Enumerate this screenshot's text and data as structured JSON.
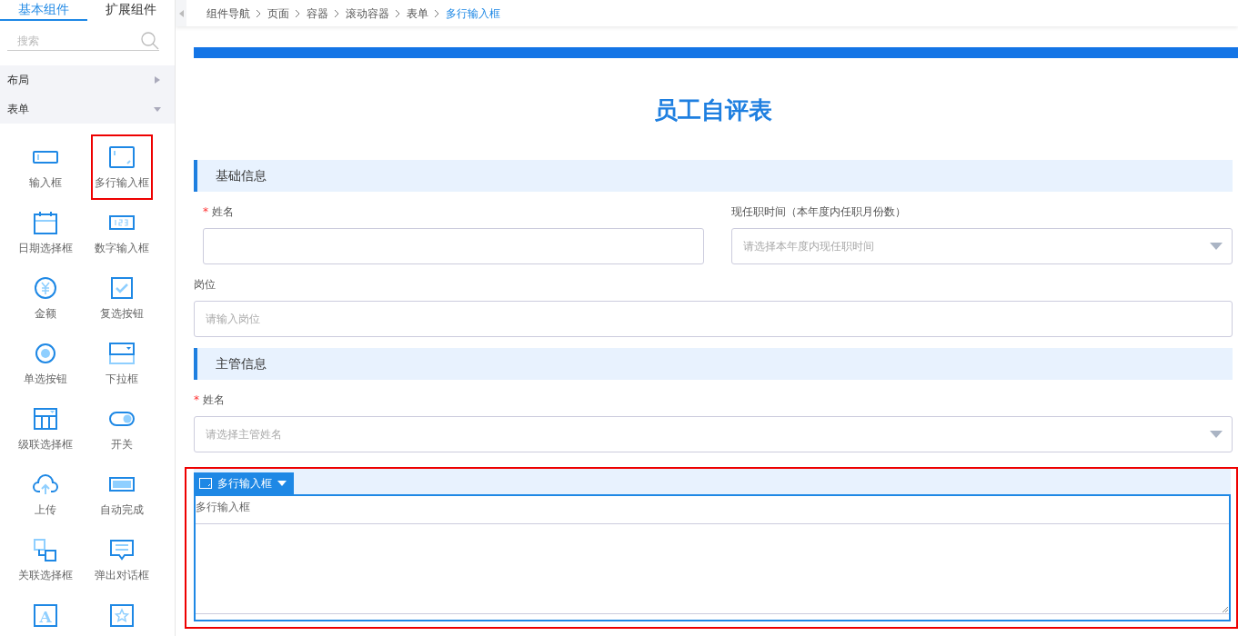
{
  "sidebar": {
    "tabs": [
      {
        "label": "基本组件",
        "selected": true
      },
      {
        "label": "扩展组件",
        "selected": false
      }
    ],
    "search": {
      "placeholder": "搜索"
    },
    "categories": [
      {
        "label": "布局",
        "expanded": false
      },
      {
        "label": "表单",
        "expanded": true
      }
    ],
    "components": [
      {
        "label": "输入框",
        "kind": "input",
        "highlighted": false
      },
      {
        "label": "多行输入框",
        "kind": "textarea",
        "highlighted": true
      },
      {
        "label": "日期选择框",
        "kind": "calendar",
        "highlighted": false
      },
      {
        "label": "数字输入框",
        "kind": "number",
        "highlighted": false
      },
      {
        "label": "金额",
        "kind": "money",
        "highlighted": false
      },
      {
        "label": "复选按钮",
        "kind": "checkbox",
        "highlighted": false
      },
      {
        "label": "单选按钮",
        "kind": "radio",
        "highlighted": false
      },
      {
        "label": "下拉框",
        "kind": "dropdown",
        "highlighted": false
      },
      {
        "label": "级联选择框",
        "kind": "cascade",
        "highlighted": false
      },
      {
        "label": "开关",
        "kind": "switch",
        "highlighted": false
      },
      {
        "label": "上传",
        "kind": "upload",
        "highlighted": false
      },
      {
        "label": "自动完成",
        "kind": "autocomplete",
        "highlighted": false
      },
      {
        "label": "关联选择框",
        "kind": "relation",
        "highlighted": false
      },
      {
        "label": "弹出对话框",
        "kind": "dialog",
        "highlighted": false
      },
      {
        "kind": "letter",
        "glyph": "A",
        "highlighted": false
      },
      {
        "kind": "star",
        "highlighted": false
      }
    ]
  },
  "breadcrumb": [
    {
      "label": "组件导航",
      "selected": false
    },
    {
      "label": "页面",
      "selected": false
    },
    {
      "label": "容器",
      "selected": false
    },
    {
      "label": "滚动容器",
      "selected": false
    },
    {
      "label": "表单",
      "selected": false
    },
    {
      "label": "多行输入框",
      "selected": true
    }
  ],
  "form": {
    "title": "员工自评表",
    "sections": [
      {
        "title": "基础信息",
        "rows": [
          [
            {
              "label": "姓名",
              "required_mark": "*",
              "kind": "text"
            },
            {
              "label": "现任职时间（本年度内任职月份数）",
              "kind": "select",
              "placeholder": "请选择本年度内现任职时间"
            }
          ],
          [
            {
              "label": "岗位",
              "kind": "text",
              "placeholder": "请输入岗位"
            }
          ]
        ]
      },
      {
        "title": "主管信息",
        "rows": [
          [
            {
              "label": "姓名",
              "required_mark": "*",
              "kind": "select",
              "placeholder": "请选择主管姓名"
            }
          ]
        ]
      }
    ],
    "selected_component": {
      "toolbar_label": "多行输入框",
      "label": "多行输入框",
      "kind": "textarea",
      "highlighted": true
    }
  }
}
